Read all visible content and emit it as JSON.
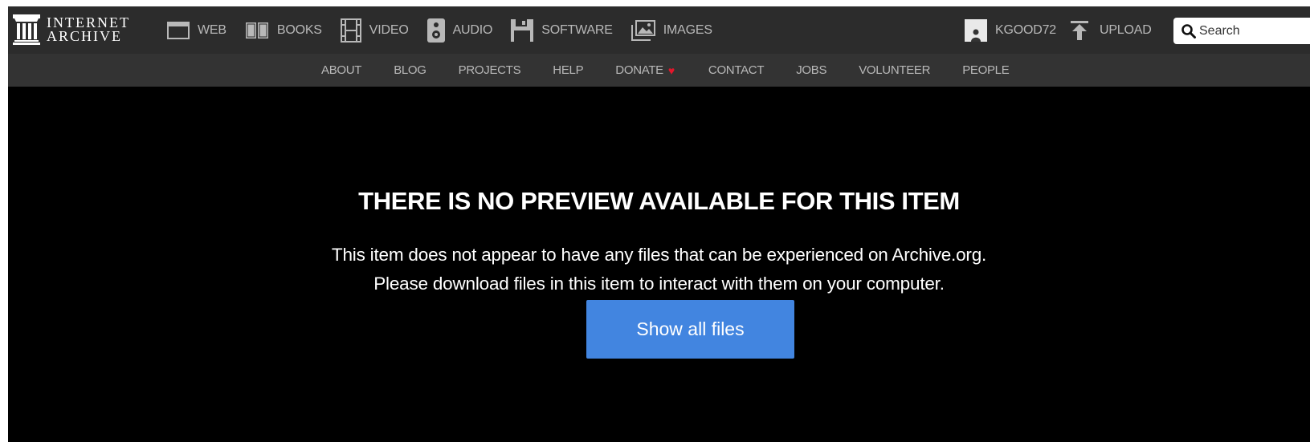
{
  "logo": {
    "line1": "INTERNET",
    "line2": "ARCHIVE",
    "icon": "archive-building-icon"
  },
  "media_nav": [
    {
      "label": "WEB",
      "icon": "web-icon"
    },
    {
      "label": "BOOKS",
      "icon": "books-icon"
    },
    {
      "label": "VIDEO",
      "icon": "video-icon"
    },
    {
      "label": "AUDIO",
      "icon": "audio-icon"
    },
    {
      "label": "SOFTWARE",
      "icon": "software-icon"
    },
    {
      "label": "IMAGES",
      "icon": "images-icon"
    }
  ],
  "user": {
    "username": "KGOOD72",
    "upload_label": "UPLOAD"
  },
  "search": {
    "placeholder": "Search"
  },
  "subnav": [
    {
      "label": "ABOUT"
    },
    {
      "label": "BLOG"
    },
    {
      "label": "PROJECTS"
    },
    {
      "label": "HELP"
    },
    {
      "label": "DONATE"
    },
    {
      "label": "CONTACT"
    },
    {
      "label": "JOBS"
    },
    {
      "label": "VOLUNTEER"
    },
    {
      "label": "PEOPLE"
    }
  ],
  "donate_heart": "♥",
  "main": {
    "heading": "THERE IS NO PREVIEW AVAILABLE FOR THIS ITEM",
    "message_line1": "This item does not appear to have any files that can be experienced on Archive.org.",
    "message_line2": "Please download files in this item to interact with them on your computer.",
    "button_label": "Show all files"
  },
  "colors": {
    "topnav_bg": "#2c2c2c",
    "subnav_bg": "#333333",
    "nav_text": "#b8b8b8",
    "button_bg": "#4285e0",
    "heart": "#e4162b"
  }
}
